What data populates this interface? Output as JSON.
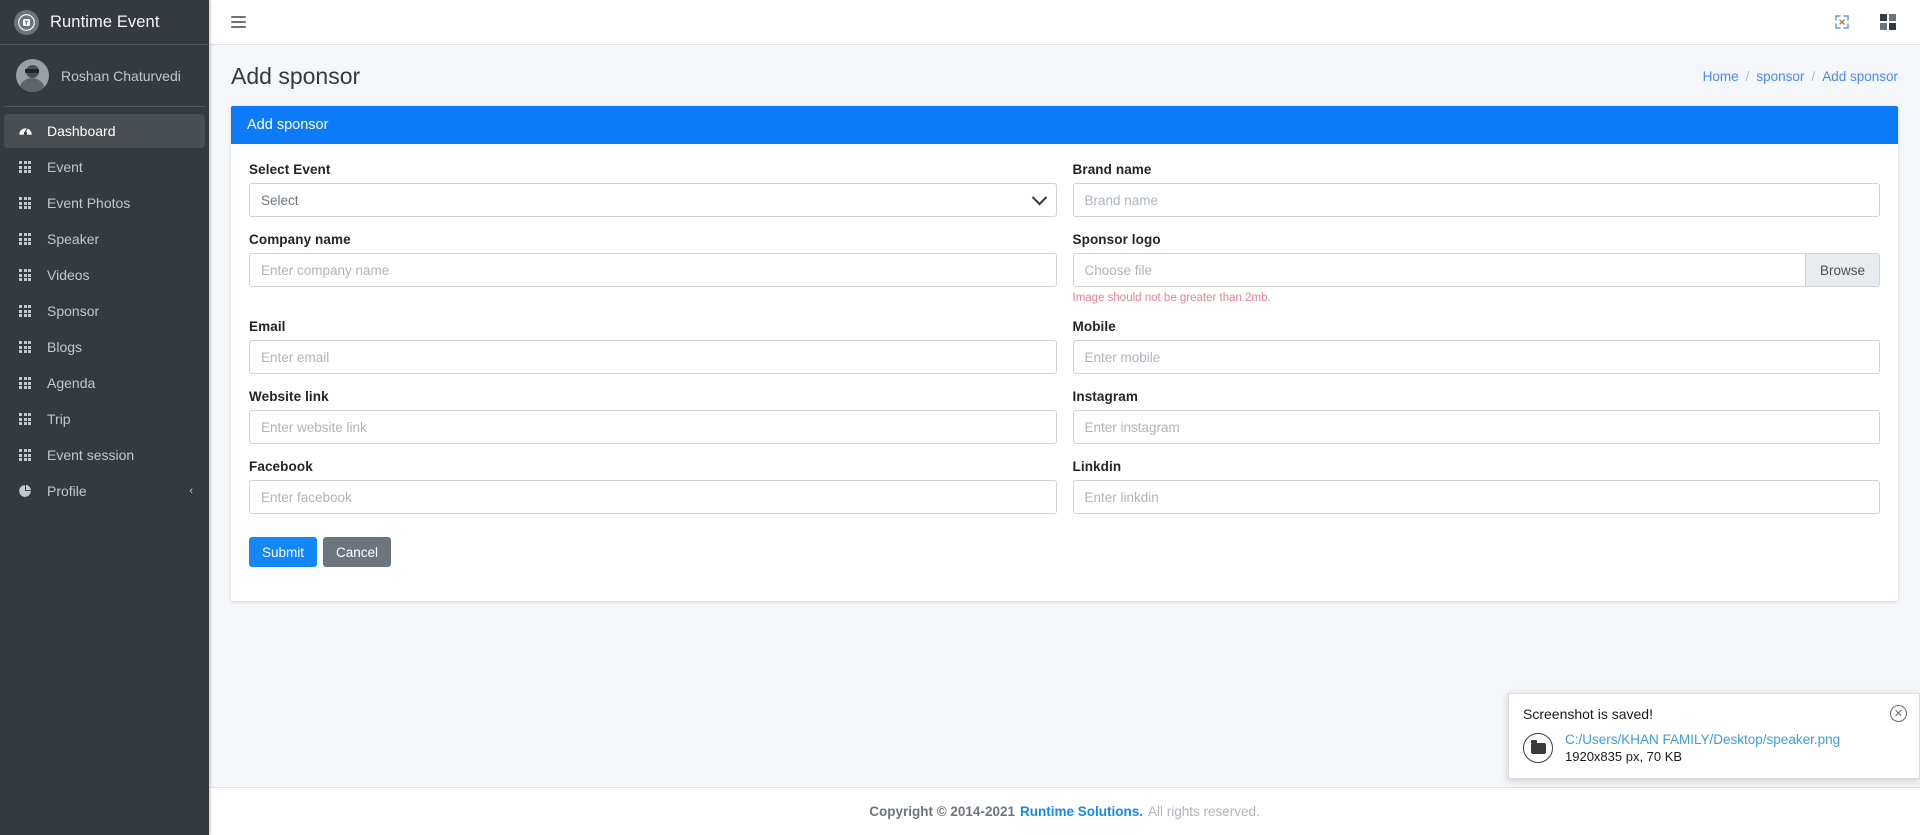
{
  "sidebar": {
    "brand": {
      "text": "Runtime Event",
      "logo_icon": "runtime-logo-icon"
    },
    "user": {
      "name": "Roshan Chaturvedi",
      "avatar_icon": "user-avatar"
    },
    "items": [
      {
        "label": "Dashboard",
        "icon": "dashboard-gauge-icon",
        "active": true
      },
      {
        "label": "Event",
        "icon": "grid-icon",
        "active": false
      },
      {
        "label": "Event Photos",
        "icon": "grid-icon",
        "active": false
      },
      {
        "label": "Speaker",
        "icon": "grid-icon",
        "active": false
      },
      {
        "label": "Videos",
        "icon": "grid-icon",
        "active": false
      },
      {
        "label": "Sponsor",
        "icon": "grid-icon",
        "active": false
      },
      {
        "label": "Blogs",
        "icon": "grid-icon",
        "active": false
      },
      {
        "label": "Agenda",
        "icon": "grid-icon",
        "active": false
      },
      {
        "label": "Trip",
        "icon": "grid-icon",
        "active": false
      },
      {
        "label": "Event session",
        "icon": "grid-icon",
        "active": false
      },
      {
        "label": "Profile",
        "icon": "pie-chart-icon",
        "active": false,
        "chevron": "‹"
      }
    ]
  },
  "topbar": {
    "menu_toggle_icon": "hamburger-icon",
    "fullscreen_icon": "expand-arrows-icon",
    "apps_icon": "grid-apps-icon"
  },
  "page": {
    "title": "Add sponsor",
    "breadcrumb": [
      {
        "label": "Home"
      },
      {
        "label": "sponsor"
      },
      {
        "label": "Add sponsor"
      }
    ],
    "breadcrumb_separator": "/"
  },
  "card": {
    "header": "Add sponsor",
    "header_color": "#0d7bf7"
  },
  "form": {
    "select_event": {
      "label": "Select Event",
      "value": "Select",
      "options": [
        "Select"
      ]
    },
    "brand_name": {
      "label": "Brand name",
      "placeholder": "Brand name",
      "value": ""
    },
    "company_name": {
      "label": "Company name",
      "placeholder": "Enter company name",
      "value": ""
    },
    "sponsor_logo": {
      "label": "Sponsor logo",
      "placeholder": "Choose file",
      "value": "",
      "browse_label": "Browse",
      "hint": "Image should not be greater than 2mb.",
      "hint_color": "#e8838f"
    },
    "email": {
      "label": "Email",
      "placeholder": "Enter email",
      "value": ""
    },
    "mobile": {
      "label": "Mobile",
      "placeholder": "Enter mobile",
      "value": ""
    },
    "website_link": {
      "label": "Website link",
      "placeholder": "Enter website link",
      "value": ""
    },
    "instagram": {
      "label": "Instagram",
      "placeholder": "Enter instagram",
      "value": ""
    },
    "facebook": {
      "label": "Facebook",
      "placeholder": "Enter facebook",
      "value": ""
    },
    "linkdin": {
      "label": "Linkdin",
      "placeholder": "Enter linkdin",
      "value": ""
    },
    "submit_label": "Submit",
    "cancel_label": "Cancel"
  },
  "footer": {
    "copyright": "Copyright © 2014-2021",
    "brand": "Runtime Solutions.",
    "rights": "All rights reserved."
  },
  "toast": {
    "title": "Screenshot is saved!",
    "path": "C:/Users/KHAN FAMILY/Desktop/speaker.png",
    "meta": "1920x835 px, 70 KB",
    "close_icon": "close-icon",
    "folder_icon": "folder-icon"
  }
}
